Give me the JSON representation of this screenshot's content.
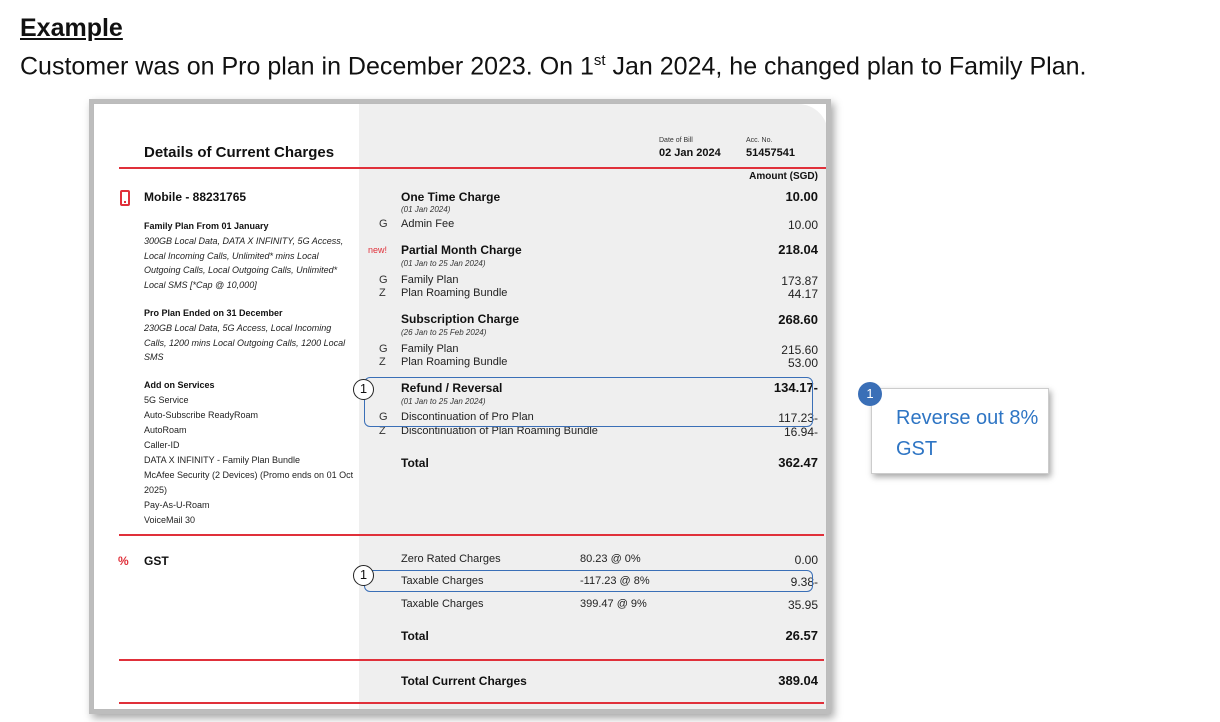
{
  "heading": "Example",
  "intro": {
    "pre": "Customer was on Pro plan in December 2023. On 1",
    "sup": "st",
    "post": " Jan 2024, he changed plan to Family Plan."
  },
  "bill": {
    "title": "Details of Current Charges",
    "date_label": "Date of Bill",
    "date_value": "02 Jan 2024",
    "acc_label": "Acc. No.",
    "acc_value": "51457541",
    "amount_header": "Amount (SGD)",
    "mobile": "Mobile - 88231765",
    "family_plan": {
      "heading": "Family Plan From 01 January",
      "details": "300GB Local Data, DATA X INFINITY, 5G Access, Local Incoming Calls, Unlimited* mins Local Outgoing Calls, Local Outgoing Calls, Unlimited* Local SMS [*Cap @ 10,000]"
    },
    "pro_plan": {
      "heading": "Pro Plan Ended on 31 December",
      "details": "230GB Local Data, 5G Access, Local Incoming Calls, 1200 mins Local Outgoing Calls, 1200 Local SMS"
    },
    "addons": {
      "heading": "Add on Services",
      "items": [
        "5G Service",
        "Auto-Subscribe ReadyRoam",
        "AutoRoam",
        "Caller-ID",
        "DATA X INFINITY - Family Plan Bundle",
        "McAfee Security (2 Devices) (Promo ends on 01 Oct 2025)",
        "Pay-As-U-Roam",
        "VoiceMail 30"
      ]
    },
    "charges": {
      "one_time": {
        "label": "One Time Charge",
        "period": "(01 Jan 2024)",
        "amount": "10.00",
        "items": [
          {
            "code": "G",
            "label": "Admin Fee",
            "amount": "10.00"
          }
        ]
      },
      "partial": {
        "tag": "new!",
        "label": "Partial Month Charge",
        "period": "(01 Jan to 25 Jan 2024)",
        "amount": "218.04",
        "items": [
          {
            "code": "G",
            "label": "Family Plan",
            "amount": "173.87"
          },
          {
            "code": "Z",
            "label": "Plan Roaming Bundle",
            "amount": "44.17"
          }
        ]
      },
      "subscription": {
        "label": "Subscription Charge",
        "period": "(26 Jan to 25 Feb 2024)",
        "amount": "268.60",
        "items": [
          {
            "code": "G",
            "label": "Family Plan",
            "amount": "215.60"
          },
          {
            "code": "Z",
            "label": "Plan Roaming Bundle",
            "amount": "53.00"
          }
        ]
      },
      "refund": {
        "label": "Refund / Reversal",
        "period": "(01 Jan to 25 Jan 2024)",
        "amount": "134.17-",
        "items": [
          {
            "code": "G",
            "label": "Discontinuation of Pro Plan",
            "amount": "117.23-"
          },
          {
            "code": "Z",
            "label": "Discontinuation of Plan Roaming Bundle",
            "amount": "16.94-"
          }
        ]
      },
      "total_label": "Total",
      "total_amount": "362.47"
    },
    "gst": {
      "symbol": "%",
      "label": "GST",
      "rows": [
        {
          "label": "Zero Rated Charges",
          "basis": "80.23 @ 0%",
          "amount": "0.00"
        },
        {
          "label": "Taxable Charges",
          "basis": "-117.23 @ 8%",
          "amount": "9.38-"
        },
        {
          "label": "Taxable Charges",
          "basis": "399.47 @ 9%",
          "amount": "35.95"
        }
      ],
      "total_label": "Total",
      "total_amount": "26.57"
    },
    "grand_total_label": "Total Current Charges",
    "grand_total_amount": "389.04",
    "callout_marker": "1"
  },
  "note": {
    "badge": "1",
    "text": "Reverse out 8% GST"
  },
  "colors": {
    "accent_red": "#e0303a",
    "callout_blue": "#3a6fb7",
    "note_text": "#2e75c4"
  }
}
